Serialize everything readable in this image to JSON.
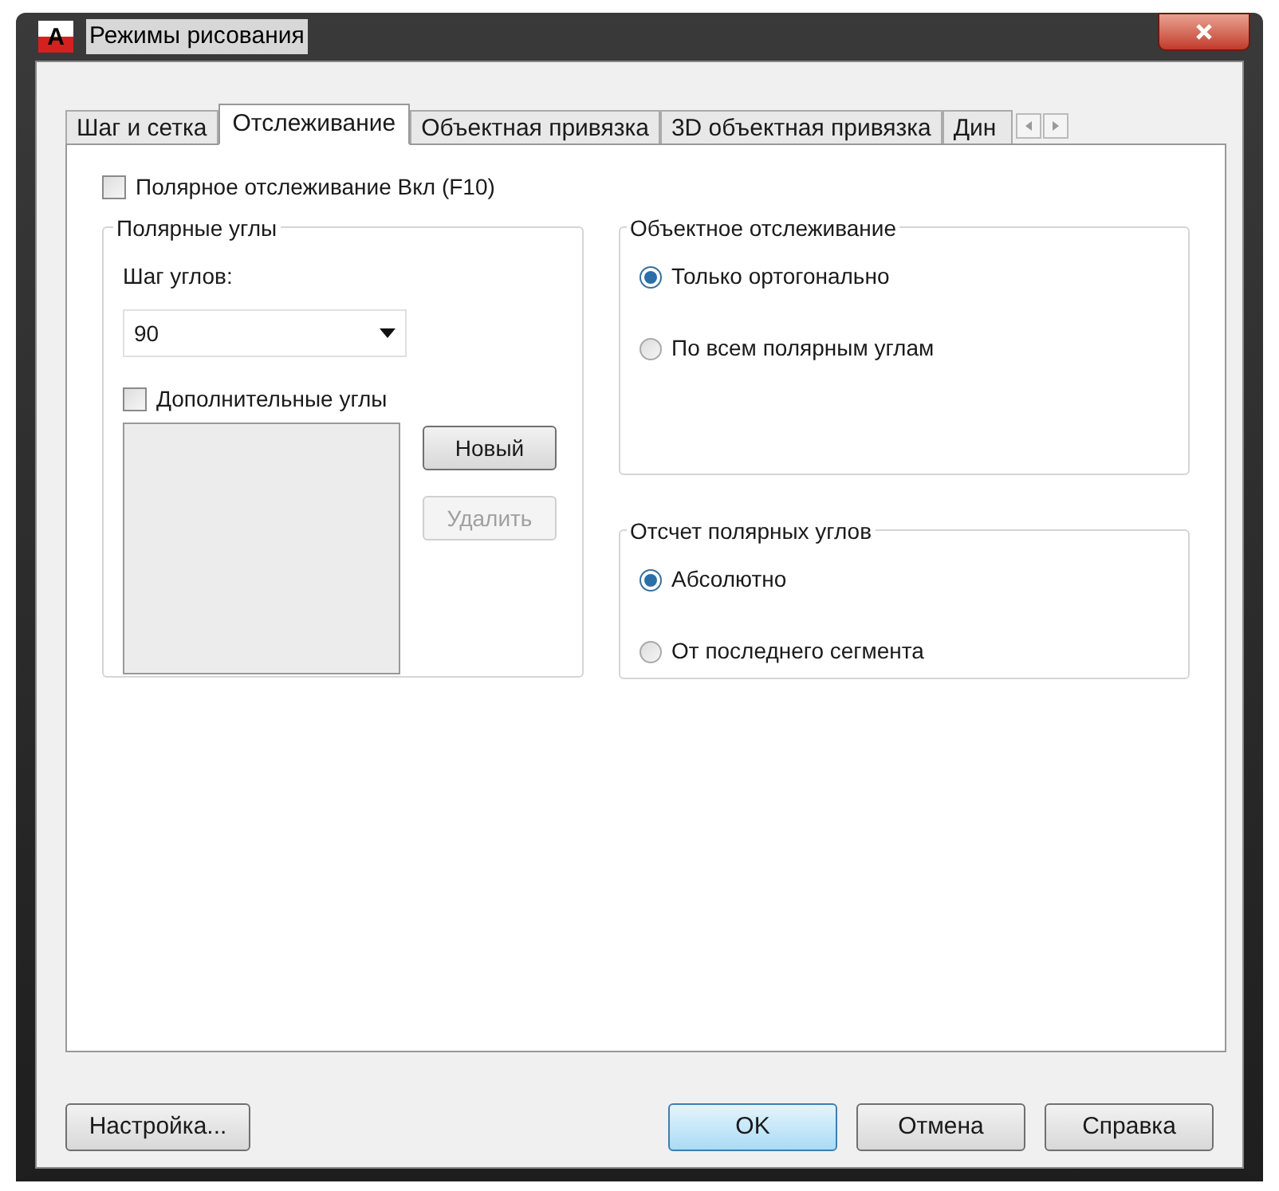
{
  "window": {
    "title": "Режимы рисования",
    "logo": "A"
  },
  "tabs": [
    {
      "label": "Шаг и сетка",
      "selected": false
    },
    {
      "label": "Отслеживание",
      "selected": true
    },
    {
      "label": "Объектная привязка",
      "selected": false
    },
    {
      "label": "3D объектная привязка",
      "selected": false
    },
    {
      "label": "Дин",
      "selected": false
    }
  ],
  "polar_tracking": {
    "label": "Полярное отслеживание Вкл (F10)",
    "checked": false
  },
  "polar_angles": {
    "title": "Полярные углы",
    "increment_label": "Шаг углов:",
    "increment_value": "90",
    "additional": {
      "label": "Дополнительные углы",
      "checked": false
    },
    "buttons": [
      {
        "label": "Новый",
        "disabled": false
      },
      {
        "label": "Удалить",
        "disabled": true
      }
    ]
  },
  "object_tracking": {
    "title": "Объектное отслеживание",
    "options": [
      {
        "label": "Только ортогонально",
        "selected": true
      },
      {
        "label": "По всем полярным углам",
        "selected": false
      }
    ]
  },
  "polar_measurement": {
    "title": "Отсчет полярных углов",
    "options": [
      {
        "label": "Абсолютно",
        "selected": true
      },
      {
        "label": "От последнего сегмента",
        "selected": false
      }
    ]
  },
  "buttons": [
    {
      "label": "Настройка...",
      "default": false
    },
    {
      "label": "OK",
      "default": true
    },
    {
      "label": "Отмена",
      "default": false
    },
    {
      "label": "Справка",
      "default": false
    }
  ]
}
